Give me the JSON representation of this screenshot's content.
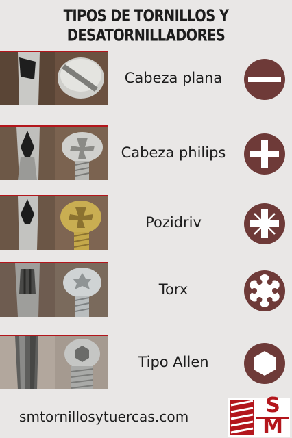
{
  "title": "TIPOS DE TORNILLOS Y DESATORNILLADORES",
  "rows": [
    {
      "label": "Cabeza plana",
      "icon": "flat-slot-icon"
    },
    {
      "label": "Cabeza philips",
      "icon": "phillips-cross-icon"
    },
    {
      "label": "Pozidriv",
      "icon": "pozidriv-icon"
    },
    {
      "label": "Torx",
      "icon": "torx-star-icon"
    },
    {
      "label": "Tipo Allen",
      "icon": "allen-hex-icon"
    }
  ],
  "footer": {
    "url": "smtornillosytuercas.com",
    "logo_letters": [
      "S",
      "M"
    ]
  },
  "colors": {
    "background": "#e9e7e6",
    "icon_fill": "#6e3a38",
    "accent_red": "#b3161c"
  }
}
